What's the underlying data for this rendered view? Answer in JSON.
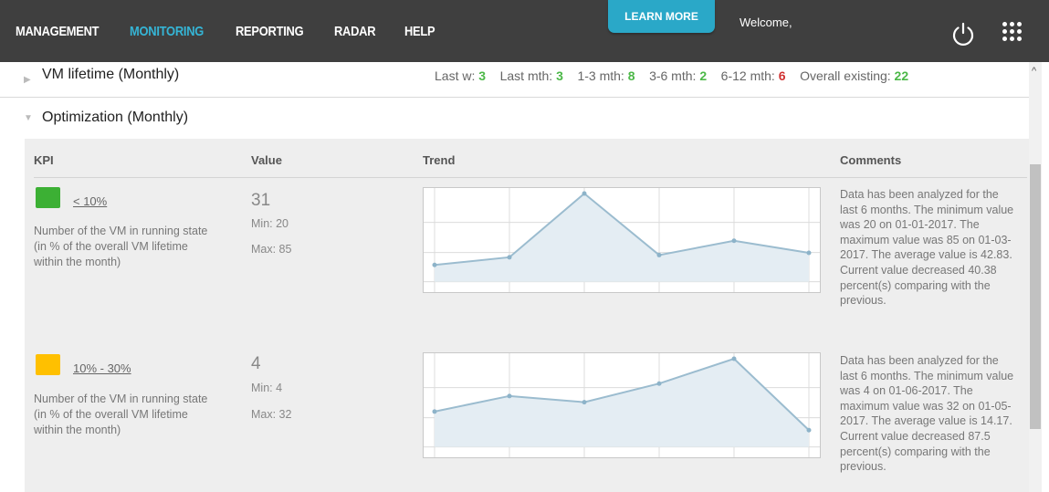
{
  "nav": {
    "items": [
      "MANAGEMENT",
      "MONITORING",
      "REPORTING",
      "RADAR",
      "HELP"
    ],
    "active": "MONITORING",
    "learn_more": "LEARN MORE",
    "welcome": "Welcome,"
  },
  "vm_lifetime": {
    "title": "VM lifetime (Monthly)",
    "stats": [
      {
        "label": "Last w:",
        "value": "3",
        "color": "#4cb848"
      },
      {
        "label": "Last mth:",
        "value": "3",
        "color": "#4cb848"
      },
      {
        "label": "1-3 mth:",
        "value": "8",
        "color": "#4cb848"
      },
      {
        "label": "3-6 mth:",
        "value": "2",
        "color": "#4cb848"
      },
      {
        "label": "6-12 mth:",
        "value": "6",
        "color": "#d03232"
      },
      {
        "label": "Overall existing:",
        "value": "22",
        "color": "#4cb848"
      }
    ]
  },
  "optimization": {
    "title": "Optimization (Monthly)",
    "headers": {
      "kpi": "KPI",
      "value": "Value",
      "trend": "Trend",
      "comments": "Comments"
    },
    "rows": [
      {
        "status_color": "#3cb034",
        "label": "< 10%",
        "description": "Number of the VM in running state (in % of the overall VM lifetime within the month)",
        "value": "31",
        "min": "Min: 20",
        "max": "Max: 85",
        "trend": [
          20,
          27,
          85,
          29,
          42,
          31
        ],
        "comment": "Data has been analyzed for the last 6 months. The minimum value was 20 on 01-01-2017. The maximum value was 85 on 01-03-2017. The average value is 42.83. Current value decreased 40.38 percent(s) comparing with the previous."
      },
      {
        "status_color": "#ffc000",
        "label": "10% - 30%",
        "description": "Number of the VM in running state (in % of the overall VM lifetime within the month)",
        "value": "4",
        "min": "Min: 4",
        "max": "Max: 32",
        "trend": [
          10,
          15,
          13,
          19,
          27,
          4
        ],
        "comment": "Data has been analyzed for the last 6 months. The minimum value was 4 on 01-06-2017. The maximum value was 32 on 01-05-2017. The average value is 14.17. Current value decreased 87.5 percent(s) comparing with the previous."
      }
    ]
  }
}
